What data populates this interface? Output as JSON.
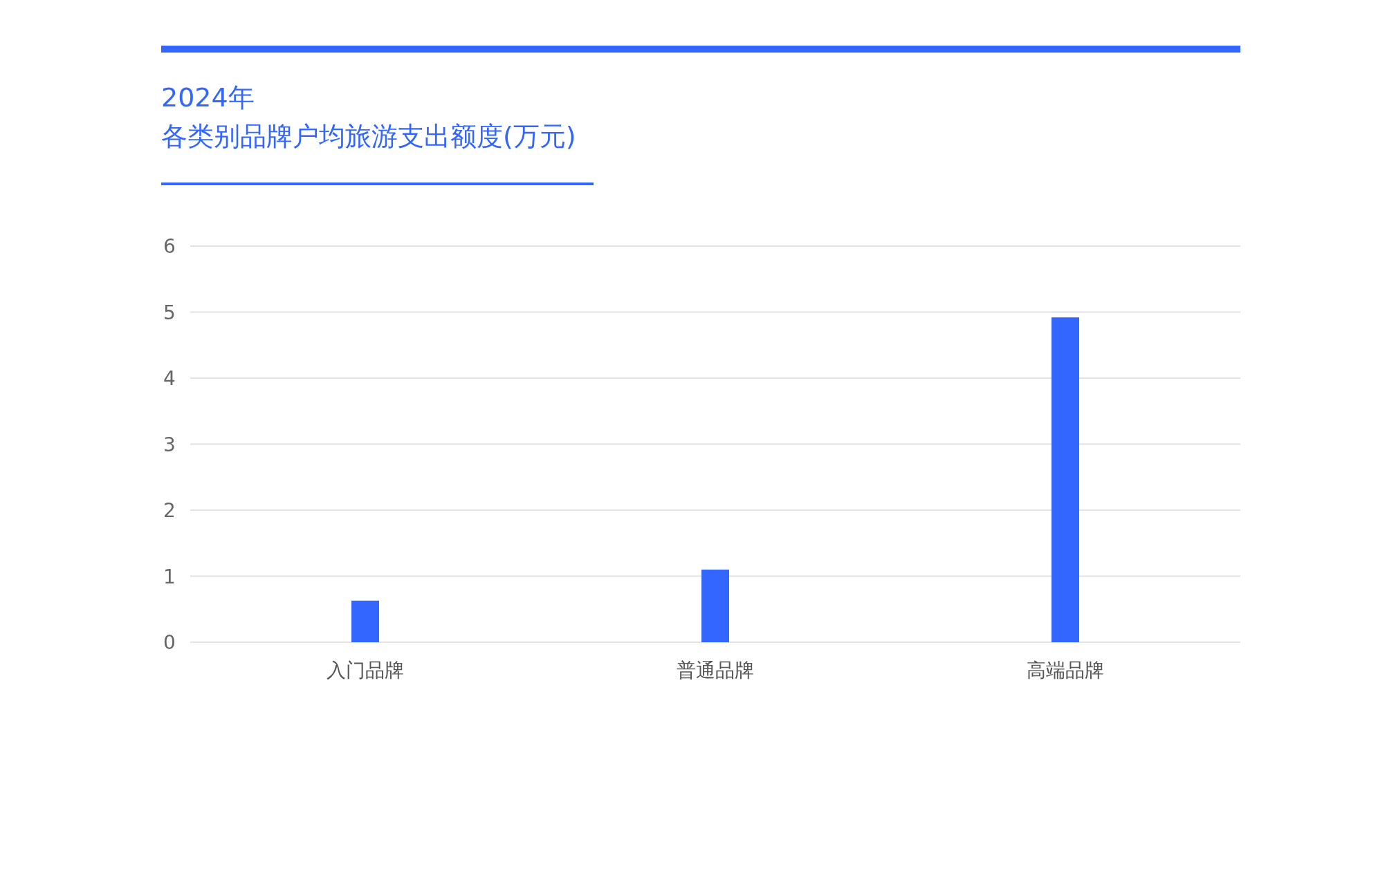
{
  "header": {
    "year": "2024年",
    "title": "各类别品牌户均旅游支出额度(万元)"
  },
  "chart_data": {
    "type": "bar",
    "categories": [
      "入门品牌",
      "普通品牌",
      "高端品牌"
    ],
    "series": [
      {
        "color": "#3366ff",
        "values": [
          0.63,
          1.1,
          4.92
        ]
      }
    ],
    "grid": true,
    "ylim": [
      0,
      6
    ],
    "yticks": [
      0,
      1,
      2,
      3,
      4,
      5,
      6
    ]
  }
}
